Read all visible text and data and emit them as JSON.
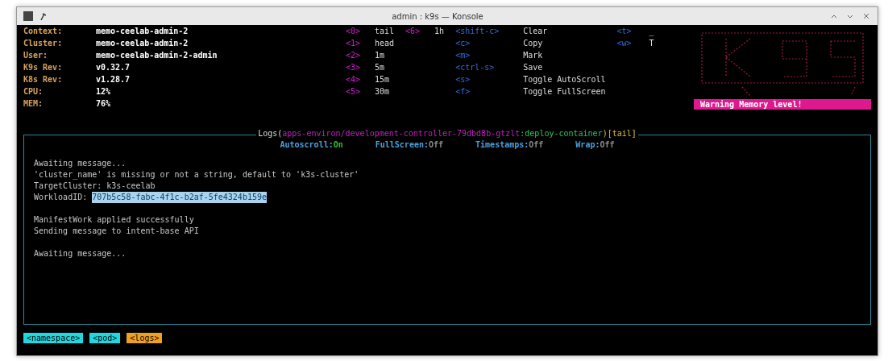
{
  "window": {
    "title": "admin : k9s — Konsole"
  },
  "cluster_info": [
    {
      "label": "Context:",
      "value": "memo-ceelab-admin-2"
    },
    {
      "label": "Cluster:",
      "value": "memo-ceelab-admin-2"
    },
    {
      "label": "User:",
      "value": "memo-ceelab-admin-2-admin"
    },
    {
      "label": "K9s Rev:",
      "value": "v0.32.7"
    },
    {
      "label": "K8s Rev:",
      "value": "v1.28.7"
    },
    {
      "label": "CPU:",
      "value": "12%"
    },
    {
      "label": "MEM:",
      "value": "76%"
    }
  ],
  "key_hints": [
    [
      {
        "key": "<0>",
        "action": "tail"
      },
      {
        "key": "<1>",
        "action": "head"
      },
      {
        "key": "<2>",
        "action": "1m"
      },
      {
        "key": "<3>",
        "action": "5m"
      },
      {
        "key": "<4>",
        "action": "15m"
      },
      {
        "key": "<5>",
        "action": "30m"
      }
    ],
    [
      {
        "key": "<6>",
        "action": "1h"
      }
    ],
    [
      {
        "key": "<shift-c>",
        "action": "Clear"
      },
      {
        "key": "<c>",
        "action": "Copy"
      },
      {
        "key": "<m>",
        "action": "Mark"
      },
      {
        "key": "<ctrl-s>",
        "action": "Save"
      },
      {
        "key": "<s>",
        "action": "Toggle AutoScroll"
      },
      {
        "key": "<f>",
        "action": "Toggle FullScreen"
      }
    ],
    [
      {
        "key": "<t>",
        "action": "_"
      },
      {
        "key": "<w>",
        "action": "T"
      }
    ]
  ],
  "flash": "Warning Memory level!",
  "logs": {
    "prefix": "Logs(",
    "pod": "apps-environ/development-controller-79dbd8b-gtzlt",
    "container": ":deploy-container",
    "suffix": ")[tail]",
    "toggles": [
      {
        "label": "Autoscroll:",
        "value": "On",
        "on": true
      },
      {
        "label": "FullScreen:",
        "value": "Off",
        "on": false
      },
      {
        "label": "Timestamps:",
        "value": "Off",
        "on": false
      },
      {
        "label": "Wrap:",
        "value": "Off",
        "on": false
      }
    ],
    "lines": [
      {
        "text": "Awaiting message..."
      },
      {
        "text": "'cluster_name' is missing or not a string, default to 'k3s-cluster'"
      },
      {
        "text": "TargetCluster: k3s-ceelab"
      },
      {
        "text": "WorkloadID: ",
        "selection": "707b5c58-fabc-4f1c-b2af-5fe4324b159e"
      },
      {
        "kind": "blank"
      },
      {
        "text": "ManifestWork applied successfully"
      },
      {
        "text": "Sending message to intent-base API"
      },
      {
        "kind": "blank"
      },
      {
        "text": "Awaiting message..."
      }
    ]
  },
  "breadcrumbs": [
    {
      "label": "<namespace>",
      "selected": false
    },
    {
      "label": "<pod>",
      "selected": false
    },
    {
      "label": "<logs>",
      "selected": true
    }
  ]
}
